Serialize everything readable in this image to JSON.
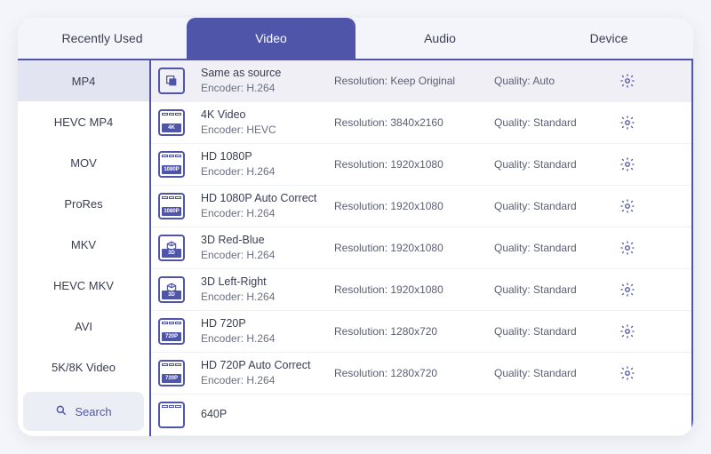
{
  "tabs": [
    {
      "label": "Recently Used",
      "active": false
    },
    {
      "label": "Video",
      "active": true
    },
    {
      "label": "Audio",
      "active": false
    },
    {
      "label": "Device",
      "active": false
    }
  ],
  "sidebar": {
    "items": [
      {
        "label": "MP4",
        "active": true
      },
      {
        "label": "HEVC MP4",
        "active": false
      },
      {
        "label": "MOV",
        "active": false
      },
      {
        "label": "ProRes",
        "active": false
      },
      {
        "label": "MKV",
        "active": false
      },
      {
        "label": "HEVC MKV",
        "active": false
      },
      {
        "label": "AVI",
        "active": false
      },
      {
        "label": "5K/8K Video",
        "active": false
      }
    ],
    "search_label": "Search"
  },
  "labels": {
    "encoder_prefix": "Encoder: ",
    "resolution_prefix": "Resolution: ",
    "quality_prefix": "Quality: "
  },
  "presets": [
    {
      "name": "Same as source",
      "encoder": "H.264",
      "resolution": "Keep Original",
      "quality": "Auto",
      "badge": "",
      "icon": "same",
      "selected": true
    },
    {
      "name": "4K Video",
      "encoder": "HEVC",
      "resolution": "3840x2160",
      "quality": "Standard",
      "badge": "4K",
      "icon": "film",
      "selected": false
    },
    {
      "name": "HD 1080P",
      "encoder": "H.264",
      "resolution": "1920x1080",
      "quality": "Standard",
      "badge": "1080P",
      "icon": "film",
      "selected": false
    },
    {
      "name": "HD 1080P Auto Correct",
      "encoder": "H.264",
      "resolution": "1920x1080",
      "quality": "Standard",
      "badge": "1080P",
      "icon": "film",
      "selected": false
    },
    {
      "name": "3D Red-Blue",
      "encoder": "H.264",
      "resolution": "1920x1080",
      "quality": "Standard",
      "badge": "3D",
      "icon": "cube",
      "selected": false
    },
    {
      "name": "3D Left-Right",
      "encoder": "H.264",
      "resolution": "1920x1080",
      "quality": "Standard",
      "badge": "3D",
      "icon": "cube",
      "selected": false
    },
    {
      "name": "HD 720P",
      "encoder": "H.264",
      "resolution": "1280x720",
      "quality": "Standard",
      "badge": "720P",
      "icon": "film",
      "selected": false
    },
    {
      "name": "HD 720P Auto Correct",
      "encoder": "H.264",
      "resolution": "1280x720",
      "quality": "Standard",
      "badge": "720P",
      "icon": "film",
      "selected": false
    },
    {
      "name": "640P",
      "encoder": "",
      "resolution": "",
      "quality": "",
      "badge": "",
      "icon": "film",
      "selected": false
    }
  ]
}
